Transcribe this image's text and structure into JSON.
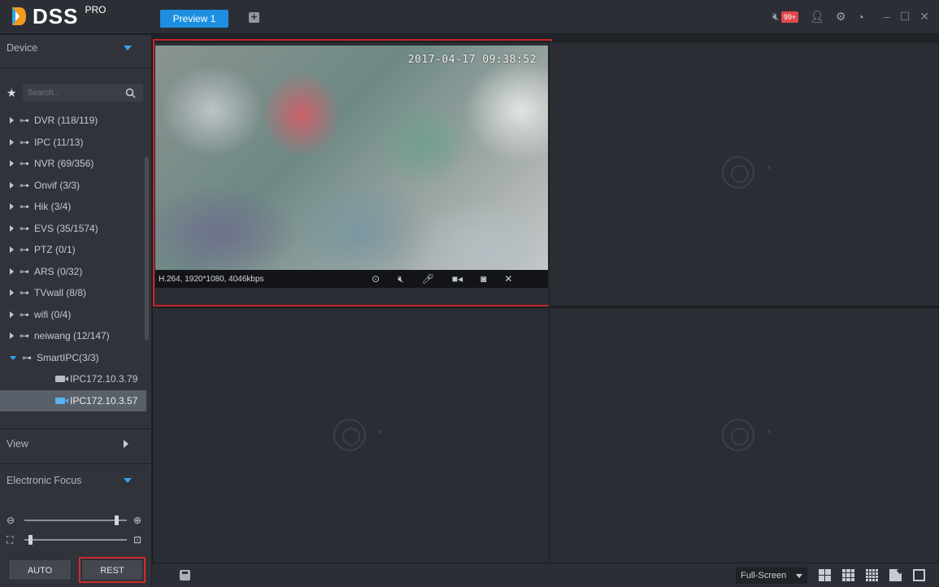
{
  "app": {
    "logo_text": "DSS",
    "logo_sup": "PRO",
    "tab_label": "Preview 1",
    "add_tab_icon": "plus-icon",
    "notification_badge": "99+",
    "accent": "#1e8fe0"
  },
  "sidebar": {
    "device_label": "Device",
    "search_placeholder": "Search..",
    "tree": [
      {
        "label": "DVR (118/119)",
        "expanded": false
      },
      {
        "label": "IPC (11/13)",
        "expanded": false
      },
      {
        "label": "NVR (69/356)",
        "expanded": false
      },
      {
        "label": "Onvif (3/3)",
        "expanded": false
      },
      {
        "label": "Hik (3/4)",
        "expanded": false
      },
      {
        "label": "EVS (35/1574)",
        "expanded": false
      },
      {
        "label": "PTZ (0/1)",
        "expanded": false
      },
      {
        "label": "ARS (0/32)",
        "expanded": false
      },
      {
        "label": "TVwall (8/8)",
        "expanded": false
      },
      {
        "label": "wifi (0/4)",
        "expanded": false
      },
      {
        "label": "neiwang (12/147)",
        "expanded": false
      },
      {
        "label": "SmartIPC(3/3)",
        "expanded": true
      }
    ],
    "children": [
      {
        "label": "IPC172.10.3.79",
        "selected": false
      },
      {
        "label": "IPC172.10.3.57",
        "selected": true
      }
    ],
    "view_label": "View",
    "focus_label": "Electronic Focus",
    "zoom_level": 0.88,
    "focus_level": 0.04,
    "auto_label": "AUTO",
    "rest_label": "REST"
  },
  "video": {
    "timestamp": "2017-04-17 09:38:52",
    "codec_info": "H.264, 1920*1080, 4046kbps",
    "controls": [
      "play-icon",
      "mute-icon",
      "mic-icon",
      "record-icon",
      "snapshot-icon",
      "close-icon"
    ]
  },
  "bottombar": {
    "fullscreen_label": "Full-Screen",
    "layout_icons": [
      "layout-4-icon",
      "layout-9-icon",
      "layout-16-icon",
      "edit-layout-icon",
      "fit-window-icon"
    ]
  }
}
